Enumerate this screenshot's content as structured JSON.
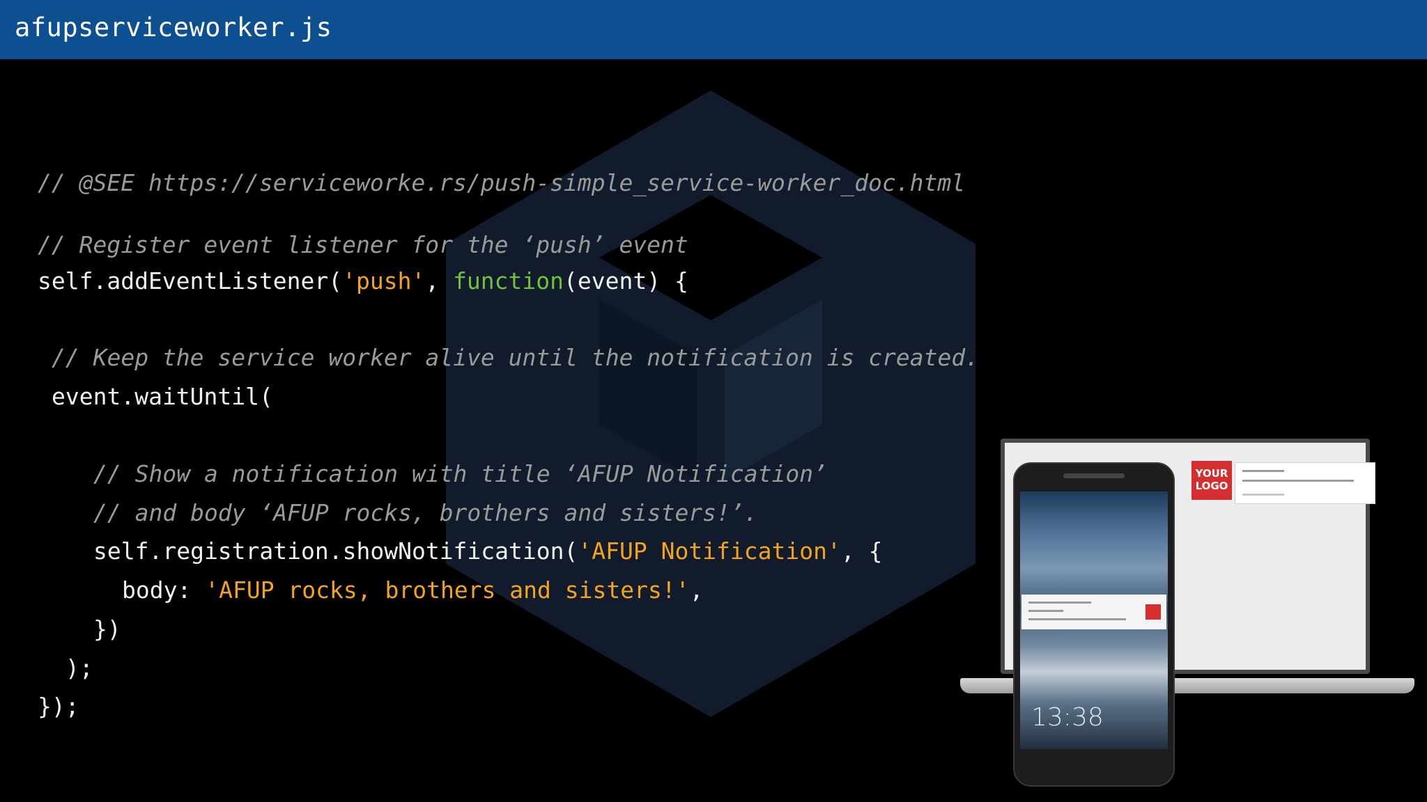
{
  "header": {
    "title": "afupserviceworker.js"
  },
  "code": {
    "line1": "// @SEE https://serviceworke.rs/push-simple_service-worker_doc.html",
    "line2": "// Register event listener for the ‘push’ event",
    "line3_a": "self.addEventListener(",
    "line3_str": "'push'",
    "line3_b": ", ",
    "line3_kw": "function",
    "line3_c": "(event) {",
    "line4": "// Keep the service worker alive until the notification is created.",
    "line5": "event.waitUntil(",
    "line6": "// Show a notification with title ‘AFUP Notification’",
    "line7": "// and body ‘AFUP rocks, brothers and sisters!’.",
    "line8_a": "self.registration.showNotification(",
    "line8_str": "'AFUP Notification'",
    "line8_b": ", {",
    "line9_a": "body: ",
    "line9_str": "'AFUP rocks, brothers and sisters!'",
    "line9_b": ",",
    "line10": "})",
    "line11": ");",
    "line12": "});"
  },
  "illustration": {
    "logo_text_1": "YOUR",
    "logo_text_2": "LOGO",
    "clock": "13:38"
  },
  "colors": {
    "header_bg": "#0c5092",
    "comment": "#9a9a9a",
    "string": "#f2a51c",
    "keyword": "#6fc23a"
  }
}
